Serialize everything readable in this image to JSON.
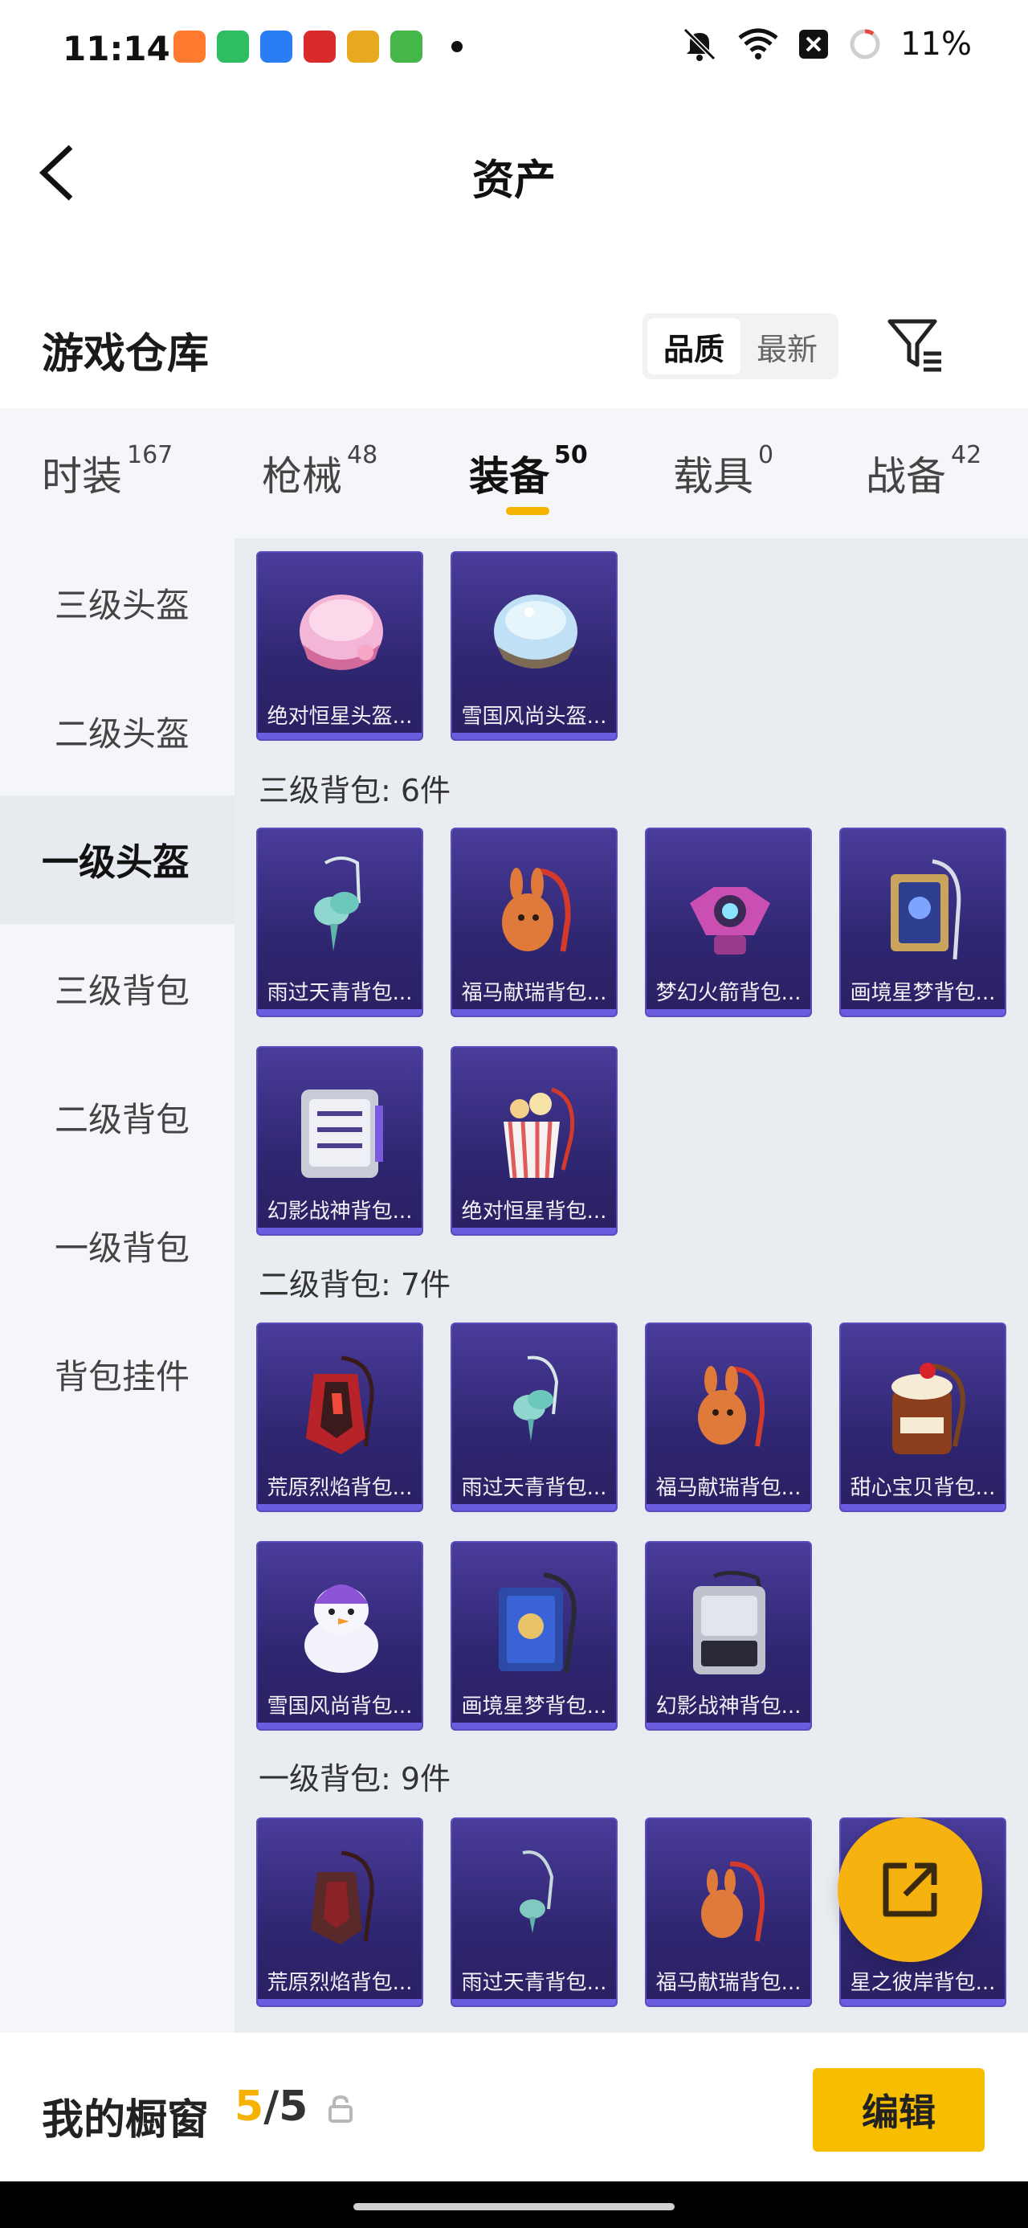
{
  "status_bar": {
    "time": "11:14",
    "battery": "11%",
    "notif_colors": [
      "#ff7a2e",
      "#2fbd62",
      "#2a7ef5",
      "#d92b2b",
      "#e7a91f",
      "#45b649"
    ]
  },
  "nav": {
    "title": "资产"
  },
  "warehouse": {
    "title": "游戏仓库",
    "sort_options": [
      "品质",
      "最新"
    ],
    "active_sort": "品质"
  },
  "tabs": [
    {
      "label": "时装",
      "count": "167"
    },
    {
      "label": "枪械",
      "count": "48"
    },
    {
      "label": "装备",
      "count": "50"
    },
    {
      "label": "载具",
      "count": "0"
    },
    {
      "label": "战备",
      "count": "42"
    }
  ],
  "active_tab": "装备",
  "side_nav": [
    "三级头盔",
    "二级头盔",
    "一级头盔",
    "三级背包",
    "二级背包",
    "一级背包",
    "背包挂件"
  ],
  "active_side": "一级头盔",
  "sections": {
    "top_items": [
      "绝对恒星头盔...",
      "雪国风尚头盔..."
    ],
    "lvl3_bag": {
      "label": "三级背包: 6件",
      "items": [
        "雨过天青背包...",
        "福马献瑞背包...",
        "梦幻火箭背包...",
        "画境星梦背包...",
        "幻影战神背包...",
        "绝对恒星背包..."
      ]
    },
    "lvl2_bag": {
      "label": "二级背包: 7件",
      "items": [
        "荒原烈焰背包...",
        "雨过天青背包...",
        "福马献瑞背包...",
        "甜心宝贝背包...",
        "雪国风尚背包...",
        "画境星梦背包...",
        "幻影战神背包..."
      ]
    },
    "lvl1_bag": {
      "label": "一级背包: 9件",
      "items": [
        "荒原烈焰背包...",
        "雨过天青背包...",
        "福马献瑞背包...",
        "星之彼岸背包..."
      ]
    }
  },
  "bottom_bar": {
    "title": "我的橱窗",
    "count_used": "5",
    "count_total": "/5",
    "edit_label": "编辑"
  },
  "colors": {
    "accent": "#f5b300",
    "card_bg": "#2f2671",
    "fab": "#f6b20e"
  }
}
